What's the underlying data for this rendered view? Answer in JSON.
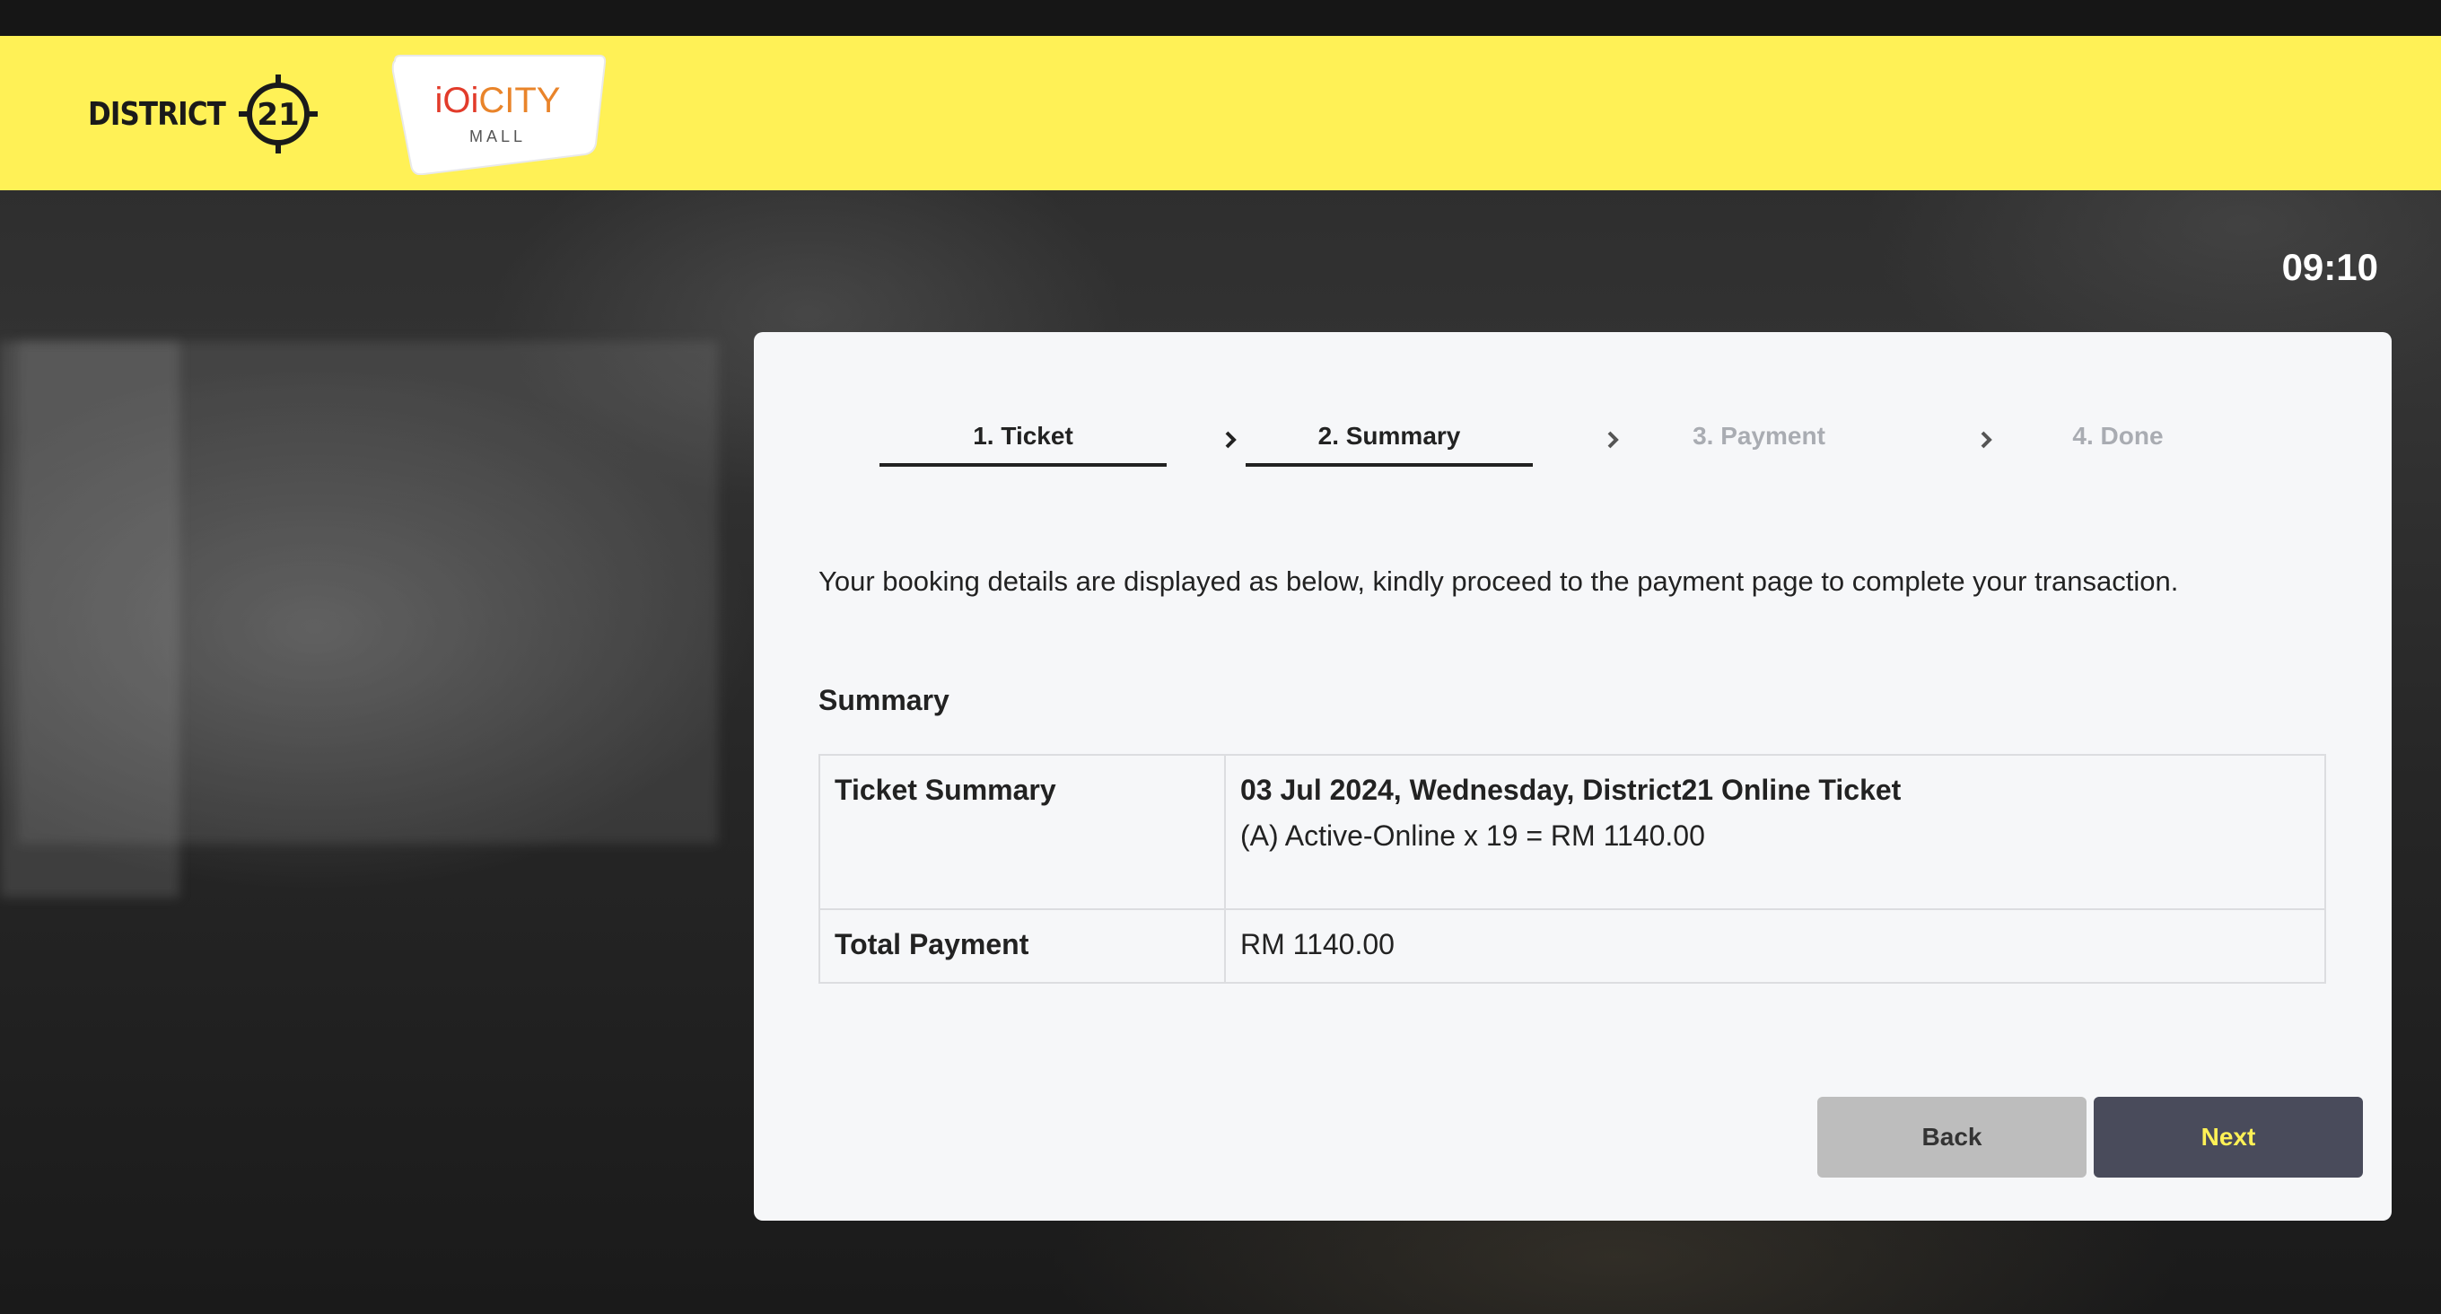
{
  "header": {
    "brand_left": "DISTRICT",
    "brand_left_number": "21",
    "brand_right_main_red": "iOi",
    "brand_right_main_orange": "CITY",
    "brand_right_sub": "MALL",
    "accent_color": "#fff156"
  },
  "clock": "09:10",
  "steps": [
    {
      "label": "1. Ticket",
      "state": "active"
    },
    {
      "label": "2. Summary",
      "state": "active"
    },
    {
      "label": "3. Payment",
      "state": "inactive"
    },
    {
      "label": "4. Done",
      "state": "inactive"
    }
  ],
  "intro": "Your booking details are displayed as below, kindly proceed to the payment page to complete your transaction.",
  "summary": {
    "title": "Summary",
    "rows": [
      {
        "label": "Ticket Summary",
        "heading": "03 Jul 2024, Wednesday, District21 Online Ticket",
        "detail": "(A) Active-Online x 19 = RM 1140.00"
      },
      {
        "label": "Total Payment",
        "value": "RM 1140.00"
      }
    ]
  },
  "buttons": {
    "back": "Back",
    "next": "Next"
  }
}
